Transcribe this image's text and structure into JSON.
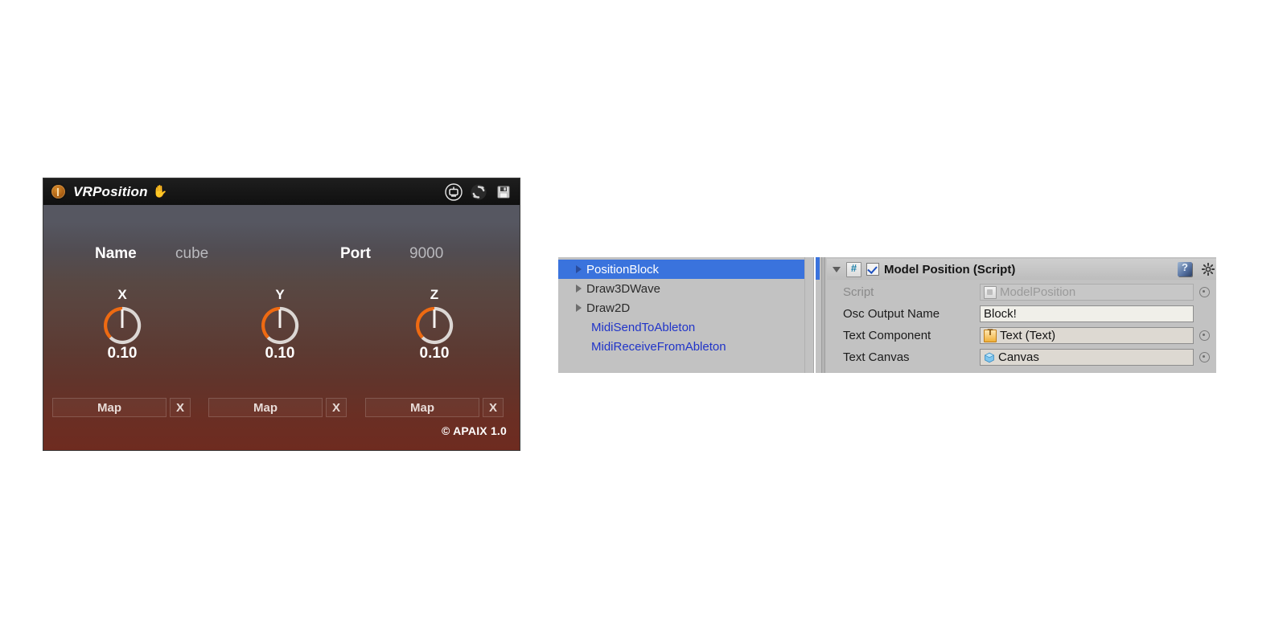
{
  "vr_panel": {
    "title": "VRPosition",
    "hand_icon": "hand-icon",
    "titlebar_icons": [
      {
        "name": "preset-window-icon",
        "label": ""
      },
      {
        "name": "refresh-icon",
        "label": ""
      },
      {
        "name": "save-disk-icon",
        "label": ""
      }
    ],
    "name_label": "Name",
    "name_value": "cube",
    "port_label": "Port",
    "port_value": "9000",
    "knobs": [
      {
        "axis": "X",
        "value": "0.10",
        "fraction": 0.1
      },
      {
        "axis": "Y",
        "value": "0.10",
        "fraction": 0.1
      },
      {
        "axis": "Z",
        "value": "0.10",
        "fraction": 0.1
      }
    ],
    "map_buttons": [
      {
        "map_label": "Map",
        "clear_label": "X"
      },
      {
        "map_label": "Map",
        "clear_label": "X"
      },
      {
        "map_label": "Map",
        "clear_label": "X"
      }
    ],
    "footer": "© APAIX 1.0",
    "colors": {
      "accent_orange": "#ee6a12",
      "knob_track": "#dcd7d4",
      "titlebar": "#141414"
    }
  },
  "hierarchy": {
    "items": [
      {
        "label": "PositionBlock",
        "selected": true,
        "expandable": true,
        "style": "selected"
      },
      {
        "label": "Draw3DWave",
        "selected": false,
        "expandable": true,
        "style": "normal"
      },
      {
        "label": "Draw2D",
        "selected": false,
        "expandable": true,
        "style": "normal"
      },
      {
        "label": "MidiSendToAbleton",
        "selected": false,
        "expandable": false,
        "style": "blue"
      },
      {
        "label": "MidiReceiveFromAbleton",
        "selected": false,
        "expandable": false,
        "style": "blue"
      }
    ]
  },
  "inspector": {
    "component_title": "Model Position (Script)",
    "enabled": true,
    "script_icon": "csharp-script-icon",
    "help_icon": "help-icon",
    "gear_icon": "gear-icon",
    "fields": [
      {
        "label": "Script",
        "value": "ModelPosition",
        "readonly": true,
        "icon": "script-asset-icon",
        "selector": true
      },
      {
        "label": "Osc Output Name",
        "value": "Block!",
        "readonly": false,
        "icon": "",
        "selector": false
      },
      {
        "label": "Text Component",
        "value": "Text (Text)",
        "readonly": false,
        "icon": "text-component-icon",
        "selector": true
      },
      {
        "label": "Text Canvas",
        "value": "Canvas",
        "readonly": false,
        "icon": "canvas-prefab-icon",
        "selector": true
      }
    ]
  }
}
